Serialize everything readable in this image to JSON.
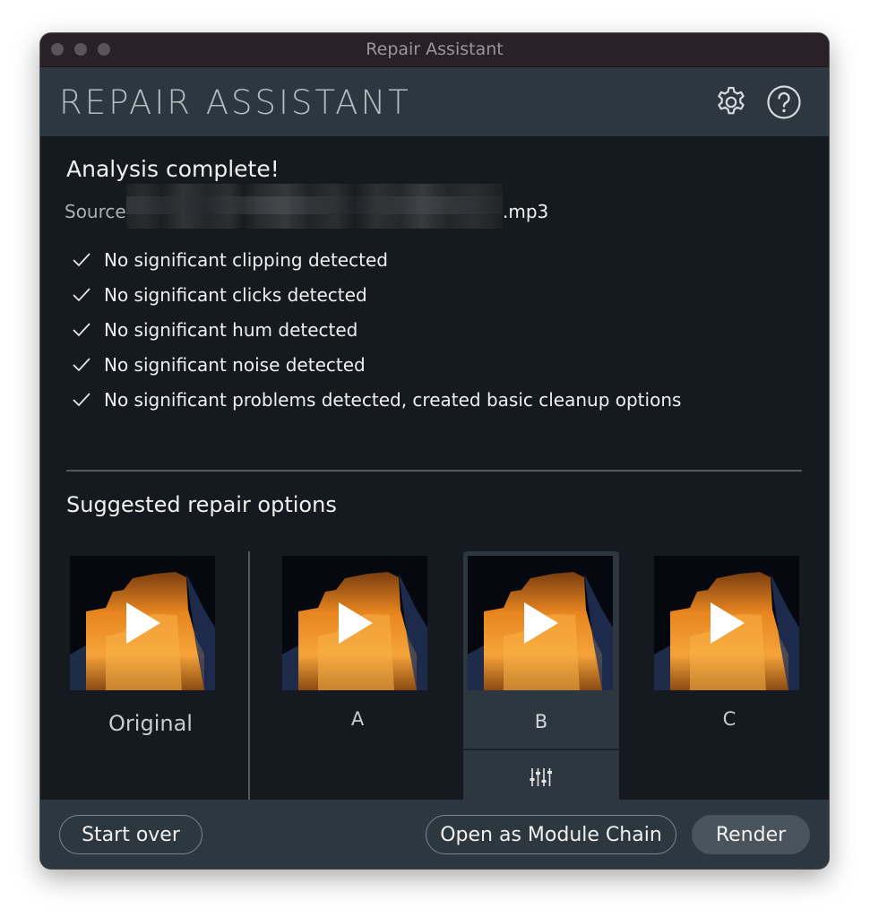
{
  "window": {
    "title": "Repair Assistant"
  },
  "header": {
    "app_title": "REPAIR ASSISTANT",
    "icons": [
      "gear-icon",
      "help-icon"
    ]
  },
  "analysis": {
    "heading": "Analysis complete!",
    "source_label": "Source",
    "source_file_visible": ".mp3",
    "results": [
      "No significant clipping detected",
      "No significant clicks detected",
      "No significant hum detected",
      "No significant noise detected",
      "No significant problems detected, created basic cleanup options"
    ]
  },
  "suggestions": {
    "heading": "Suggested repair options",
    "options": [
      {
        "label": "Original"
      },
      {
        "label": "A"
      },
      {
        "label": "B",
        "selected": true
      },
      {
        "label": "C"
      }
    ]
  },
  "footer": {
    "start_over": "Start over",
    "open_module_chain": "Open as Module Chain",
    "render": "Render"
  },
  "colors": {
    "accent_orange": "#f08a1c",
    "panel": "#2d373f",
    "background": "#141a1f"
  }
}
